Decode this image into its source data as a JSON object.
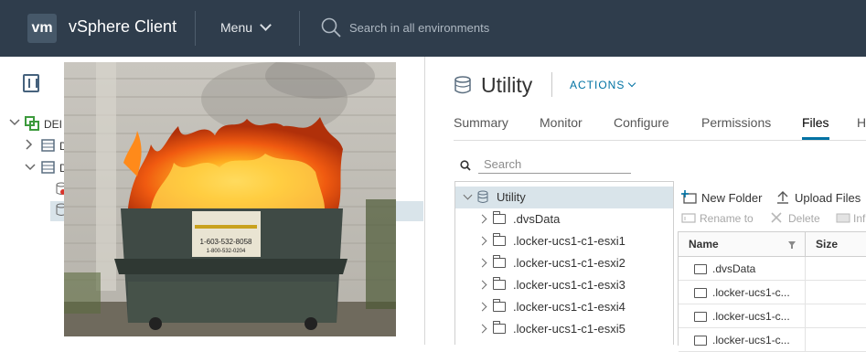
{
  "header": {
    "logo": "vm",
    "app_name": "vSphere Client",
    "menu_label": "Menu",
    "search_placeholder": "Search in all environments"
  },
  "navigator": {
    "tree_truncated": [
      "DEI",
      "D",
      "D"
    ]
  },
  "object": {
    "title": "Utility",
    "actions_label": "ACTIONS"
  },
  "tabs": [
    {
      "label": "Summary",
      "active": false
    },
    {
      "label": "Monitor",
      "active": false
    },
    {
      "label": "Configure",
      "active": false
    },
    {
      "label": "Permissions",
      "active": false
    },
    {
      "label": "Files",
      "active": true
    },
    {
      "label": "H",
      "active": false
    }
  ],
  "files": {
    "search_placeholder": "Search",
    "tree": [
      {
        "label": "Utility",
        "selected": true,
        "expanded": true
      },
      {
        "label": ".dvsData"
      },
      {
        "label": ".locker-ucs1-c1-esxi1"
      },
      {
        "label": ".locker-ucs1-c1-esxi2"
      },
      {
        "label": ".locker-ucs1-c1-esxi3"
      },
      {
        "label": ".locker-ucs1-c1-esxi4"
      },
      {
        "label": ".locker-ucs1-c1-esxi5"
      }
    ],
    "toolbar": {
      "new_folder": "New Folder",
      "upload_files": "Upload Files",
      "rename_to": "Rename to",
      "delete": "Delete",
      "info": "Inf"
    },
    "grid": {
      "columns": [
        "Name",
        "Size"
      ],
      "rows": [
        ".dvsData",
        ".locker-ucs1-c...",
        ".locker-ucs1-c...",
        ".locker-ucs1-c..."
      ]
    }
  },
  "photo": {
    "stamp_lines": [
      "1-603-532-8058",
      "1-800-532-0204"
    ]
  },
  "colors": {
    "header_bg": "#2f3d4c",
    "accent": "#0072a3",
    "selection": "#d9e4ea"
  }
}
